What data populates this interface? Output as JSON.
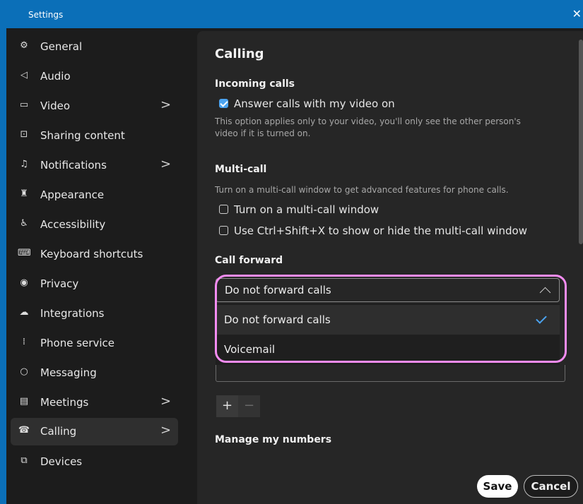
{
  "window": {
    "title": "Settings",
    "close_glyph": "✕"
  },
  "sidebar": {
    "items": [
      {
        "label": "General",
        "icon": "gear-icon",
        "glyph": "⚙"
      },
      {
        "label": "Audio",
        "icon": "speaker-icon",
        "glyph": "◁"
      },
      {
        "label": "Video",
        "icon": "video-camera-icon",
        "glyph": "▭"
      },
      {
        "label": "Sharing content",
        "icon": "share-screen-icon",
        "glyph": "⊡"
      },
      {
        "label": "Notifications",
        "icon": "bell-icon",
        "glyph": "♫"
      },
      {
        "label": "Appearance",
        "icon": "paint-bucket-icon",
        "glyph": "♜"
      },
      {
        "label": "Accessibility",
        "icon": "accessibility-icon",
        "glyph": "♿"
      },
      {
        "label": "Keyboard shortcuts",
        "icon": "keyboard-icon",
        "glyph": "⌨"
      },
      {
        "label": "Privacy",
        "icon": "privacy-icon",
        "glyph": "◉"
      },
      {
        "label": "Integrations",
        "icon": "cloud-icon",
        "glyph": "☁"
      },
      {
        "label": "Phone service",
        "icon": "dialpad-icon",
        "glyph": "⁞"
      },
      {
        "label": "Messaging",
        "icon": "chat-bubble-icon",
        "glyph": "○"
      },
      {
        "label": "Meetings",
        "icon": "calendar-icon",
        "glyph": "▤"
      },
      {
        "label": "Calling",
        "icon": "phone-icon",
        "glyph": "☎"
      },
      {
        "label": "Devices",
        "icon": "devices-icon",
        "glyph": "⧉"
      }
    ],
    "chevron": ">"
  },
  "main": {
    "title": "Calling",
    "incoming": {
      "heading": "Incoming calls",
      "answer_video_label": "Answer calls with my video on",
      "answer_video_checked": true,
      "note_line1": "This option applies only to your video, you'll only see the other person's",
      "note_line2": "video if it is turned on."
    },
    "multicall": {
      "heading": "Multi-call",
      "description": "Turn on a multi-call window to get advanced features for phone calls.",
      "opt1_label": "Turn on a multi-call window",
      "opt1_checked": false,
      "opt2_label": "Use Ctrl+Shift+X to show or hide the multi-call window",
      "opt2_checked": false
    },
    "call_forward": {
      "heading": "Call forward",
      "selected": "Do not forward calls",
      "options": [
        "Do not forward calls",
        "Voicemail"
      ]
    },
    "plus_label": "+",
    "minus_label": "−",
    "manage_heading": "Manage my numbers"
  },
  "footer": {
    "save_label": "Save",
    "cancel_label": "Cancel"
  },
  "colors": {
    "accent": "#4ba3f0",
    "titlebar": "#0b6fb8",
    "highlight_annotation": "#f58cf2"
  }
}
